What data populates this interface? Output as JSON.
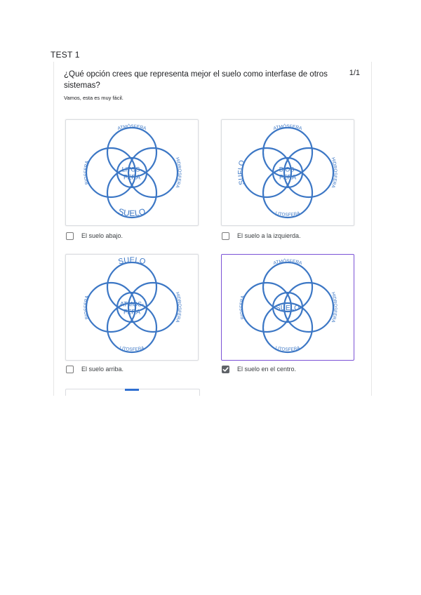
{
  "page": {
    "title": "TEST 1"
  },
  "question": {
    "text": "¿Qué opción crees que representa mejor el suelo como interfase de otros sistemas?",
    "score": "1/1",
    "hint": "Vamos, esta es muy fácil."
  },
  "options": [
    {
      "label": "El suelo abajo.",
      "checked": false,
      "diagram": {
        "top": "ATMÓSFERA",
        "right": "HIDROSFERA",
        "left": "BIOSFERA",
        "bottom": "SUELO",
        "center": [
          "LITOS-",
          "FERA"
        ]
      }
    },
    {
      "label": "El suelo a la izquierda.",
      "checked": false,
      "diagram": {
        "top": "ATMÓSFERA",
        "right": "HIDROSFERA",
        "left": "SUELO",
        "bottom": "LITOSFERA",
        "center": [
          "BIOS-",
          "FERA"
        ]
      }
    },
    {
      "label": "El suelo arriba.",
      "checked": false,
      "diagram": {
        "top": "SUELO",
        "right": "HIDROSFERA",
        "left": "BIOSFERA",
        "bottom": "LITOSFERA",
        "center": [
          "ATMÓS-",
          "FERA"
        ]
      }
    },
    {
      "label": "El suelo en el centro.",
      "checked": true,
      "diagram": {
        "top": "ATMÓSFERA",
        "right": "HIDROSFERA",
        "left": "BIOSFERA",
        "bottom": "LITOSFERA",
        "center": [
          "SUELO"
        ]
      }
    }
  ],
  "colors": {
    "venn": "#3c77c5",
    "selected_border": "#7b52d6",
    "checkbox_checked": "#5f6368"
  },
  "icons": {
    "checkbox": "checkbox-icon",
    "check": "checkmark-icon"
  }
}
